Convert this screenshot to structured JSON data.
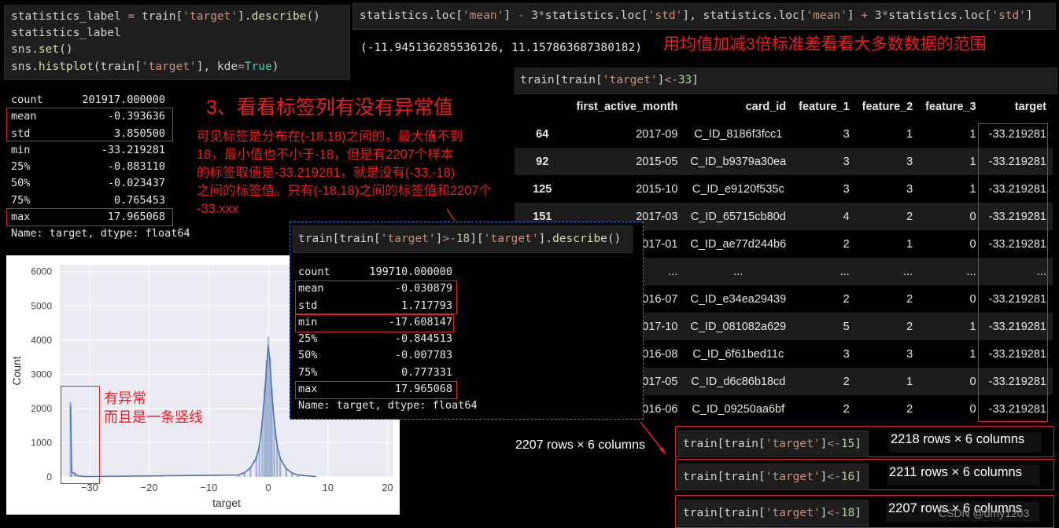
{
  "cells": {
    "cell1": {
      "line1_var": "statistics_label",
      "line1_eq": " = ",
      "line1_obj": "train[",
      "line1_key": "'target'",
      "line1_close": "].",
      "line1_fn": "describe",
      "line1_end": "()",
      "line2": "statistics_label",
      "line3_obj": "sns.",
      "line3_fn": "set",
      "line3_end": "()",
      "line4_obj": "sns.",
      "line4_fn": "histplot",
      "line4_a": "(train[",
      "line4_key": "'target'",
      "line4_b": "], kde",
      "line4_eq": "=",
      "line4_true": "True",
      "line4_end": ")"
    },
    "describe1": [
      {
        "k": "count",
        "v": "201917.000000"
      },
      {
        "k": "mean",
        "v": "-0.393636"
      },
      {
        "k": "std",
        "v": "3.850500"
      },
      {
        "k": "min",
        "v": "-33.219281"
      },
      {
        "k": "25%",
        "v": "-0.883110"
      },
      {
        "k": "50%",
        "v": "-0.023437"
      },
      {
        "k": "75%",
        "v": "0.765453"
      },
      {
        "k": "max",
        "v": "17.965068"
      }
    ],
    "describe1_footer": "Name: target, dtype: float64",
    "cell_range": {
      "a": "statistics.loc[",
      "k1": "'mean'",
      "b": "] ",
      "m1": "-",
      "c": " ",
      "n1": "3",
      "star1": "*",
      "d": "statistics.loc[",
      "k2": "'std'",
      "e": "], statistics.loc[",
      "k3": "'mean'",
      "f": "] ",
      "p1": "+",
      "g": " ",
      "n2": "3",
      "star2": "*",
      "h": "statistics.loc[",
      "k4": "'std'",
      "i": "]"
    },
    "range_output": "(-11.945136285536126, 11.157863687380182)",
    "range_note": "用均值加减3倍标准差看看大多数数据的范围",
    "cell_filter33": {
      "a": "train[train[",
      "k": "'target'",
      "b": "]",
      "op": "<-",
      "n": "33",
      "c": "]"
    },
    "section_title": "3、看看标签列有没有异常值",
    "explanation": [
      "可见标签是分布在(-18,18)之间的，最大值不到",
      "18，最小值也不小于-18，但是有2207个样本",
      "的标签取值是-33.219281，就是没有(-33,-18)",
      "之间的标签值。只有(-18,18)之间的标签值和2207个",
      "-33.xxx"
    ],
    "cell_filter18": {
      "a": "train[train[",
      "k": "'target'",
      "b": "]",
      "op": ">-",
      "n": "18",
      "c": "][",
      "k2": "'target'",
      "d": "].",
      "fn": "describe",
      "e": "()"
    },
    "describe2": [
      {
        "k": "count",
        "v": "199710.000000"
      },
      {
        "k": "mean",
        "v": "-0.030879"
      },
      {
        "k": "std",
        "v": "1.717793"
      },
      {
        "k": "min",
        "v": "-17.608147"
      },
      {
        "k": "25%",
        "v": "-0.844513"
      },
      {
        "k": "50%",
        "v": "-0.007783"
      },
      {
        "k": "75%",
        "v": "0.777331"
      },
      {
        "k": "max",
        "v": "17.965068"
      }
    ],
    "describe2_footer": "Name: target, dtype: float64"
  },
  "dataframe": {
    "columns": [
      "first_active_month",
      "card_id",
      "feature_1",
      "feature_2",
      "feature_3",
      "target"
    ],
    "rows": [
      {
        "idx": "64",
        "cells": [
          "2017-09",
          "C_ID_8186f3fcc1",
          "3",
          "1",
          "1",
          "-33.219281"
        ]
      },
      {
        "idx": "92",
        "cells": [
          "2015-05",
          "C_ID_b9379a30ea",
          "3",
          "3",
          "1",
          "-33.219281"
        ]
      },
      {
        "idx": "125",
        "cells": [
          "2015-10",
          "C_ID_e9120f535c",
          "3",
          "3",
          "1",
          "-33.219281"
        ]
      },
      {
        "idx": "151",
        "cells": [
          "2017-03",
          "C_ID_65715cb80d",
          "4",
          "2",
          "0",
          "-33.219281"
        ]
      },
      {
        "idx": "",
        "cells": [
          "017-01",
          "C_ID_ae77d244b6",
          "2",
          "1",
          "0",
          "-33.219281"
        ]
      },
      {
        "idx": "",
        "cells": [
          "...",
          "...",
          "...",
          "...",
          "...",
          "..."
        ]
      },
      {
        "idx": "",
        "cells": [
          "016-07",
          "C_ID_e34ea29439",
          "2",
          "2",
          "0",
          "-33.219281"
        ]
      },
      {
        "idx": "",
        "cells": [
          "017-10",
          "C_ID_081082a629",
          "5",
          "2",
          "1",
          "-33.219281"
        ]
      },
      {
        "idx": "",
        "cells": [
          "016-08",
          "C_ID_6f61bed11c",
          "3",
          "3",
          "1",
          "-33.219281"
        ]
      },
      {
        "idx": "",
        "cells": [
          "017-05",
          "C_ID_d6c86b18cd",
          "2",
          "1",
          "0",
          "-33.219281"
        ]
      },
      {
        "idx": "",
        "cells": [
          "016-06",
          "C_ID_09250aa6bf",
          "2",
          "2",
          "0",
          "-33.219281"
        ]
      }
    ],
    "shape": "2207 rows × 6 columns"
  },
  "filters": [
    {
      "a": "train[train[",
      "k": "'target'",
      "b": "]",
      "op": "<-",
      "n": "15",
      "c": "]",
      "result": "2218 rows × 6 columns"
    },
    {
      "a": "train[train[",
      "k": "'target'",
      "b": "]",
      "op": "<-",
      "n": "16",
      "c": "]",
      "result": "2211 rows × 6 columns"
    },
    {
      "a": "train[train[",
      "k": "'target'",
      "b": "]",
      "op": "<-",
      "n": "18",
      "c": "]",
      "result": "2207 rows × 6 columns"
    }
  ],
  "watermark": "CSDN @dmy1203",
  "histogram_note": [
    "有异常",
    "而且是一条竖线"
  ],
  "chart_data": {
    "type": "bar",
    "title": "",
    "xlabel": "target",
    "ylabel": "Count",
    "xlim": [
      -35,
      21
    ],
    "ylim": [
      0,
      6200
    ],
    "xticks": [
      -30,
      -20,
      -10,
      0,
      10,
      20
    ],
    "yticks": [
      0,
      1000,
      2000,
      3000,
      4000,
      5000,
      6000
    ],
    "x": [
      -33.2,
      -33.0,
      -32.5,
      -32.0,
      -31.0,
      -5,
      -4,
      -3,
      -2,
      -1.5,
      -1,
      -0.6,
      -0.3,
      0,
      0.3,
      0.6,
      1,
      1.5,
      2,
      3,
      4,
      5,
      8
    ],
    "values": [
      2200,
      150,
      110,
      40,
      10,
      60,
      130,
      280,
      600,
      950,
      1700,
      2600,
      3400,
      4100,
      3500,
      2600,
      1700,
      950,
      580,
      260,
      120,
      60,
      10
    ],
    "kde": true,
    "color": "#4c72b0",
    "grid": true
  }
}
